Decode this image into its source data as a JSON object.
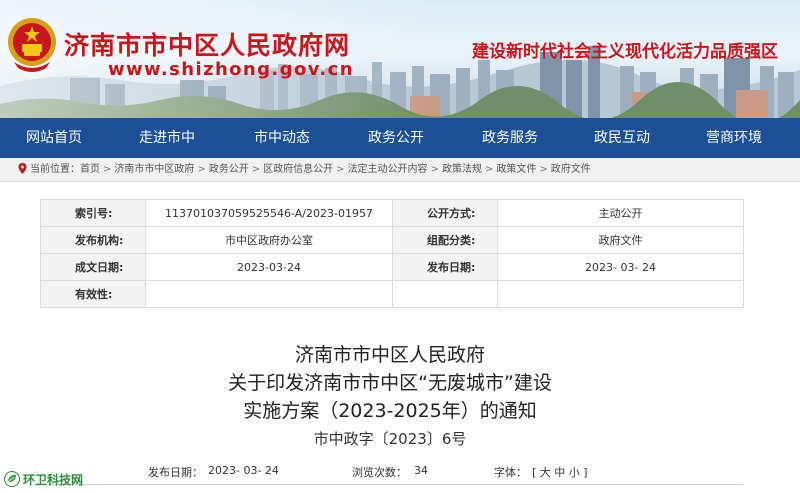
{
  "header": {
    "site_title": "济南市市中区人民政府网",
    "site_url": "www.shizhong.gov.cn",
    "slogan": "建设新时代社会主义现代化活力品质强区"
  },
  "nav": {
    "items": [
      {
        "label": "网站首页"
      },
      {
        "label": "走进市中"
      },
      {
        "label": "市中动态"
      },
      {
        "label": "政务公开"
      },
      {
        "label": "政务服务"
      },
      {
        "label": "政民互动"
      },
      {
        "label": "营商环境"
      }
    ]
  },
  "breadcrumb": {
    "prefix": "当前位置：",
    "items": [
      "首页",
      "济南市市中区政府",
      "政务公开",
      "区政府信息公开",
      "法定主动公开内容",
      "政策法规",
      "政策文件",
      "政府文件"
    ],
    "separator": ">"
  },
  "info": {
    "rows": [
      {
        "label1": "索引号:",
        "value1": "113701037059525546-A/2023-01957",
        "label2": "公开方式:",
        "value2": "主动公开"
      },
      {
        "label1": "发布机构:",
        "value1": "市中区政府办公室",
        "label2": "组配分类:",
        "value2": "政府文件"
      },
      {
        "label1": "成文日期:",
        "value1": "2023-03-24",
        "label2": "发布日期:",
        "value2": "2023- 03- 24"
      },
      {
        "label1": "有效性:",
        "value1": "",
        "label2": "",
        "value2": ""
      }
    ]
  },
  "document": {
    "title_lines": [
      "济南市市中区人民政府",
      "关于印发济南市市中区“无废城市”建设",
      "实施方案（2023-2025年）的通知"
    ],
    "doc_number": "市中政字〔2023〕6号"
  },
  "meta": {
    "publish_label": "发布日期：",
    "publish_value": "2023- 03- 24",
    "views_label": "浏览次数：",
    "views_value": "34",
    "font_label": "字体：",
    "font_control": "[ 大 中 小 ]"
  },
  "watermark": {
    "text": "环卫科技网"
  },
  "colors": {
    "brand_red": "#c8161d",
    "nav_blue": "#1c4f96",
    "watermark_green": "#2b8c3a"
  },
  "icons": {
    "emblem": "national-emblem",
    "location": "location-pin-icon",
    "watermark": "leaf-logo-icon"
  }
}
